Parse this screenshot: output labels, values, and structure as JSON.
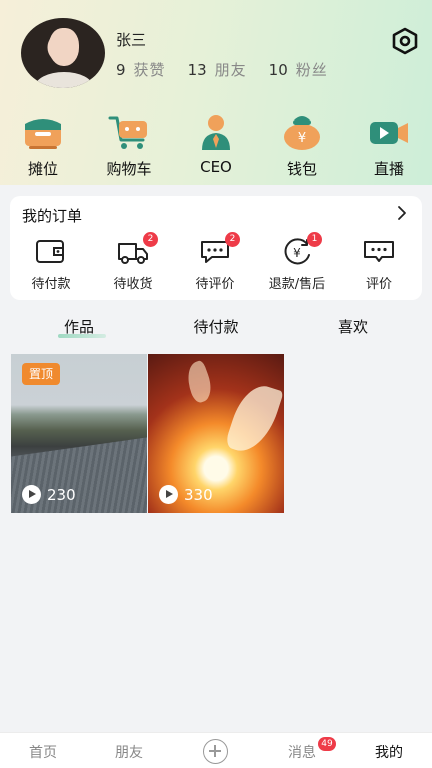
{
  "profile": {
    "username": "张三",
    "stats": [
      {
        "num": "9",
        "label": "获赞"
      },
      {
        "num": "13",
        "label": "朋友"
      },
      {
        "num": "10",
        "label": "粉丝"
      }
    ]
  },
  "quick_actions": [
    {
      "label": "摊位",
      "icon": "stall-icon"
    },
    {
      "label": "购物车",
      "icon": "shopping-cart-icon"
    },
    {
      "label": "CEO",
      "icon": "ceo-icon"
    },
    {
      "label": "钱包",
      "icon": "wallet-icon"
    },
    {
      "label": "直播",
      "icon": "live-icon"
    }
  ],
  "orders": {
    "title": "我的订单",
    "items": [
      {
        "label": "待付款",
        "icon": "wallet-outline-icon",
        "badge": ""
      },
      {
        "label": "待收货",
        "icon": "truck-icon",
        "badge": "2"
      },
      {
        "label": "待评价",
        "icon": "chat-bubble-icon",
        "badge": "2"
      },
      {
        "label": "退款/售后",
        "icon": "refund-icon",
        "badge": "1"
      },
      {
        "label": "评价",
        "icon": "comment-icon",
        "badge": ""
      }
    ]
  },
  "tabs": [
    {
      "label": "作品",
      "active": true
    },
    {
      "label": "待付款",
      "active": false
    },
    {
      "label": "喜欢",
      "active": false
    }
  ],
  "works": [
    {
      "pinned_label": "置顶",
      "plays": "230"
    },
    {
      "pinned_label": "",
      "plays": "330"
    }
  ],
  "bottom_nav": {
    "home": "首页",
    "friends": "朋友",
    "messages": "消息",
    "messages_badge": "49",
    "me": "我的"
  },
  "colors": {
    "accent": "#f08a2e",
    "badge": "#ee3b48",
    "tab_underline": "#9fd9c2"
  }
}
